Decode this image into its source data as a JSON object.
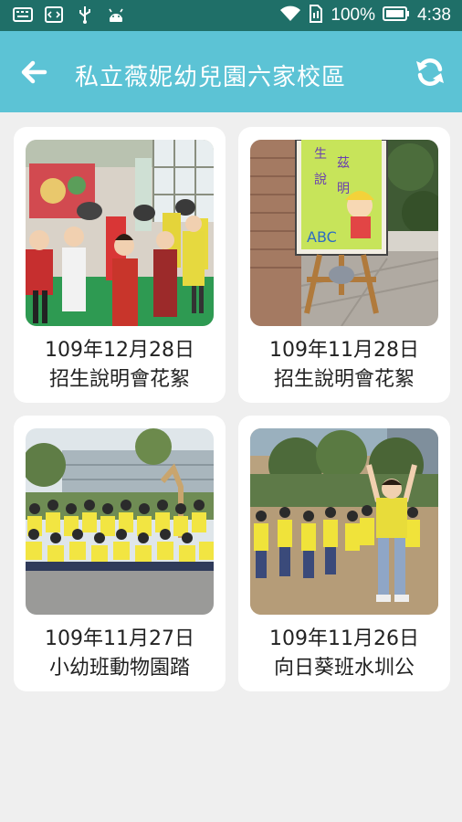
{
  "status_bar": {
    "battery_percent": "100%",
    "time": "4:38",
    "icons": [
      "keyboard-icon",
      "code-icon",
      "usb-icon",
      "android-icon",
      "wifi-icon",
      "sim-icon",
      "battery-icon"
    ]
  },
  "header": {
    "title": "私立薇妮幼兒園六家校區",
    "back_icon": "arrow-left-icon",
    "refresh_icon": "refresh-icon"
  },
  "colors": {
    "status_bar": "#1f6f68",
    "app_bar": "#5cc3d5",
    "background": "#efefef"
  },
  "albums": [
    {
      "date": "109年12月28日",
      "caption": "招生說明會花絮"
    },
    {
      "date": "109年11月28日",
      "caption": "招生說明會花絮"
    },
    {
      "date": "109年11月27日",
      "caption": "小幼班動物園踏"
    },
    {
      "date": "109年11月26日",
      "caption": "向日葵班水圳公"
    }
  ]
}
